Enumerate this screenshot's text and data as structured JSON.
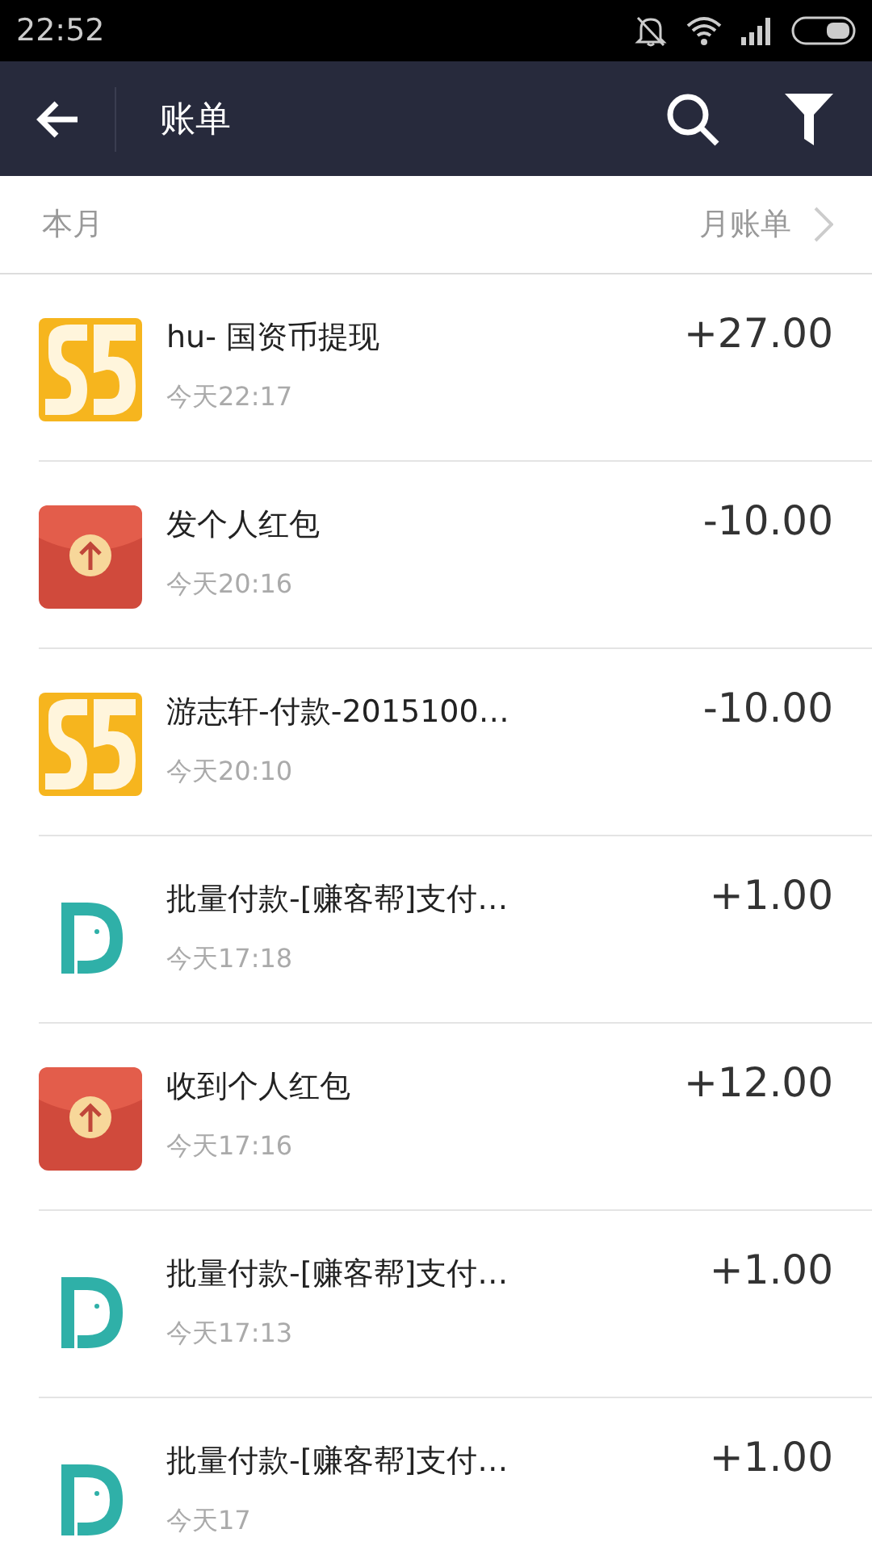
{
  "status_bar": {
    "time": "22:52"
  },
  "header": {
    "title": "账单"
  },
  "month_bar": {
    "label": "本月",
    "link": "月账单"
  },
  "transactions": [
    {
      "kind": "s5",
      "title": "hu- 国资币提现",
      "time": "今天22:17",
      "amount": "+27.00"
    },
    {
      "kind": "redpacket",
      "title": "发个人红包",
      "time": "今天20:16",
      "amount": "-10.00"
    },
    {
      "kind": "s5",
      "title": "游志轩-付款-2015100…",
      "time": "今天20:10",
      "amount": "-10.00"
    },
    {
      "kind": "d",
      "title": "批量付款-[赚客帮]支付…",
      "time": "今天17:18",
      "amount": "+1.00"
    },
    {
      "kind": "redpacket",
      "title": "收到个人红包",
      "time": "今天17:16",
      "amount": "+12.00"
    },
    {
      "kind": "d",
      "title": "批量付款-[赚客帮]支付…",
      "time": "今天17:13",
      "amount": "+1.00"
    },
    {
      "kind": "d",
      "title": "批量付款-[赚客帮]支付…",
      "time": "今天17",
      "amount": "+1.00"
    }
  ]
}
